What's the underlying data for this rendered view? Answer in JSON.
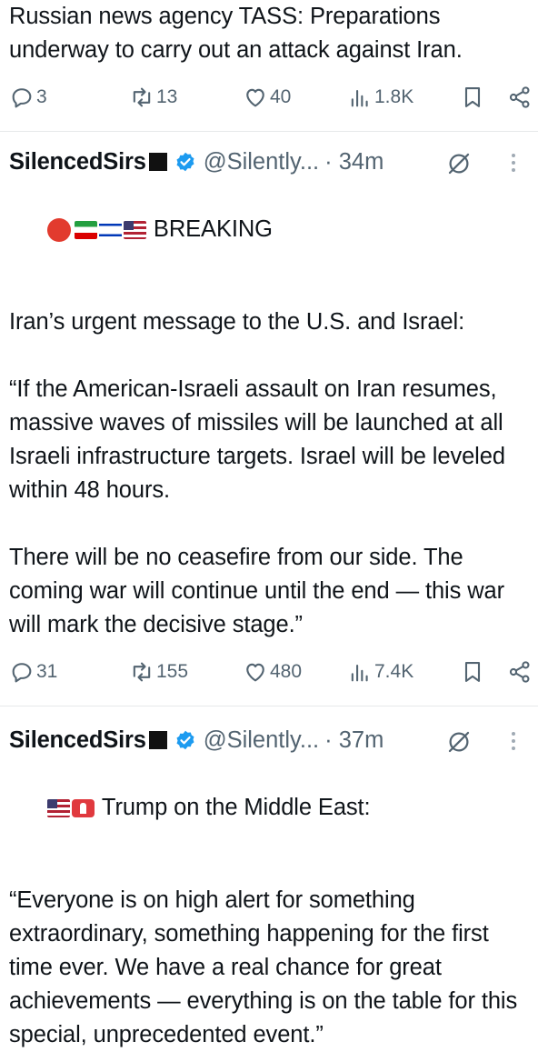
{
  "post_top": {
    "text": "Russian news agency TASS: Preparations underway to carry out an attack against Iran.",
    "replies": "3",
    "reposts": "13",
    "likes": "40",
    "views": "1.8K"
  },
  "post_middle": {
    "display_name": "SilencedSirs",
    "handle": "@Silently...",
    "time": "· 34m",
    "headline": "BREAKING",
    "body": "Iran’s urgent message to the U.S. and Israel:\n\n“If the American-Israeli assault on Iran resumes, massive waves of missiles will be launched at all Israeli infrastructure targets. Israel will be leveled within 48 hours.\n\nThere will be no ceasefire from our side. The coming war will continue until the end — this war will mark the decisive stage.”",
    "replies": "31",
    "reposts": "155",
    "likes": "480",
    "views": "7.4K"
  },
  "post_bottom": {
    "display_name": "SilencedSirs",
    "handle": "@Silently...",
    "time": "· 37m",
    "headline": "Trump on the Middle East:",
    "body": "“Everyone is on high alert for something extraordinary, something happening for the first time ever. We have a real chance for great achievements — everything is on the table for this special, unprecedented event.”"
  },
  "icons": {
    "reply": "reply-icon",
    "repost": "repost-icon",
    "like": "heart-icon",
    "views": "views-icon",
    "bookmark": "bookmark-icon",
    "share": "share-icon",
    "verified": "verified-badge-icon",
    "grok": "grok-icon",
    "more": "more-options-icon"
  },
  "colors": {
    "text": "#0f1419",
    "secondary": "#536471",
    "accent": "#1d9bf0",
    "divider": "#e7e9ea"
  }
}
